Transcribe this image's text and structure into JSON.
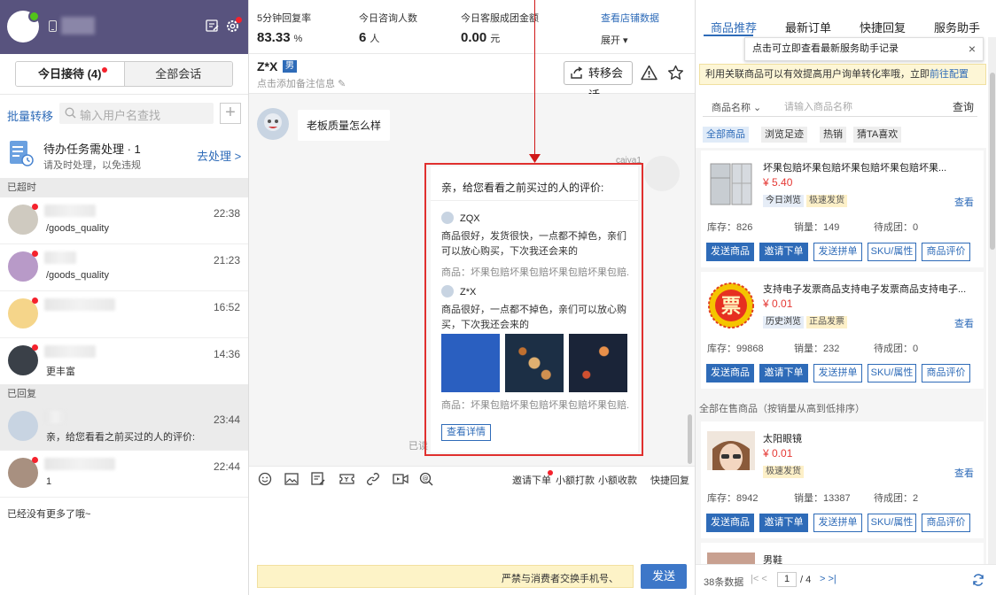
{
  "left": {
    "tabs": {
      "today": "今日接待 (4)",
      "all": "全部会话"
    },
    "batch_transfer": "批量转移",
    "search_placeholder": "输入用户名查找",
    "add_label": "+",
    "task": {
      "title": "待办任务需处理 · 1",
      "subtitle": "请及时处理，以免违规",
      "action": "去处理 >"
    },
    "sections": {
      "overdue": "已超时",
      "replied": "已回复"
    },
    "conversations": [
      {
        "time": "22:38",
        "msg": "/goods_quality",
        "avatar_color": "#cfcac0"
      },
      {
        "time": "21:23",
        "msg": "/goods_quality",
        "avatar_color": "#b89ac8"
      },
      {
        "time": "16:52",
        "msg": "",
        "avatar_color": "#f5d58a"
      },
      {
        "time": "14:36",
        "msg": "更丰富",
        "avatar_color": "#3a4048"
      },
      {
        "time": "23:44",
        "msg": "亲，给您看看之前买过的人的评价:",
        "avatar_color": "#c8d4e2"
      },
      {
        "time": "22:44",
        "msg": "1",
        "avatar_color": "#a89080"
      }
    ],
    "no_more": "已经没有更多了哦~"
  },
  "stats": {
    "reply_rate": {
      "label": "5分钟回复率",
      "value": "83.33",
      "unit": "%"
    },
    "consult": {
      "label": "今日咨询人数",
      "value": "6",
      "unit": "人"
    },
    "amount": {
      "label": "今日客服成团金额",
      "value": "0.00",
      "unit": "元"
    },
    "shop_link": "查看店铺数据",
    "expand": "展开 ▾"
  },
  "chat": {
    "customer": "Z*X",
    "gender": "男",
    "note": "点击添加备注信息",
    "transfer": "转移会话",
    "message_in": "老板质量怎么样",
    "sender": "caiya1",
    "read": "已读",
    "card": {
      "title": "亲，给您看看之前买过的人的评价:",
      "reviews": [
        {
          "user": "ZQX",
          "text": "商品很好，发货很快，一点都不掉色，亲们可以放心购买，下次我还会来的",
          "product": "商品：坏果包赔坏果包赔坏果包赔坏果包赔..."
        },
        {
          "user": "Z*X",
          "text": "商品很好，一点都不掉色，亲们可以放心购买，下次我还会来的",
          "product": "商品：坏果包赔坏果包赔坏果包赔坏果包赔..."
        }
      ],
      "detail": "查看详情"
    },
    "toolbar": {
      "invite": "邀请下单",
      "small_pay": "小额打款",
      "small_collect": "小额收款",
      "quick_reply": "快捷回复"
    },
    "input_notice": "严禁与消费者交换手机号、",
    "send": "发送"
  },
  "right": {
    "tabs": [
      "商品推荐",
      "最新订单",
      "快捷回复",
      "服务助手"
    ],
    "tooltip": "点击可立即查看最新服务助手记录",
    "tooltip_close": "×",
    "notice": "利用关联商品可以有效提高用户询单转化率哦，立即",
    "notice_link": "前往配置",
    "search": {
      "select": "商品名称 ⌄",
      "placeholder": "请输入商品名称",
      "button": "查询"
    },
    "chips": [
      "全部商品",
      "浏览足迹",
      "热销",
      "猜TA喜欢"
    ],
    "all_on_sale": "全部在售商品（按销量从高到低排序）",
    "stat_labels": {
      "stock": "库存",
      "sales": "销量",
      "pending": "待成团"
    },
    "product_buttons": [
      "发送商品",
      "邀请下单",
      "发送拼单",
      "SKU/属性",
      "商品评价"
    ],
    "view": "查看",
    "products": [
      {
        "name": "坏果包赔坏果包赔坏果包赔坏果包赔坏果...",
        "price": "¥ 5.40",
        "tags": [
          "今日浏览",
          "极速发货"
        ],
        "stock": "库存：826",
        "sales": "销量：149",
        "pending": "待成团：0"
      },
      {
        "name": "支持电子发票商品支持电子发票商品支持电子...",
        "price": "¥ 0.01",
        "tags": [
          "历史浏览",
          "正品发票"
        ],
        "stock": "库存：99868",
        "sales": "销量：232",
        "pending": "待成团：0"
      },
      {
        "name": "太阳眼镜",
        "price": "¥ 0.01",
        "tags": [
          "极速发货"
        ],
        "stock": "库存：8942",
        "sales": "销量：13387",
        "pending": "待成团：2"
      },
      {
        "name": "男鞋",
        "price": "",
        "tags": [],
        "stock": "",
        "sales": "",
        "pending": ""
      }
    ],
    "pager": {
      "count": "38条数据",
      "first_prev": "|< <",
      "page": "1",
      "total": "/ 4",
      "next_last": "> >|"
    }
  },
  "colors": {
    "header_purple": "#58537e",
    "brand_blue": "#2e6bb8",
    "price_red": "#e53935",
    "highlight_red": "#e0302e"
  }
}
